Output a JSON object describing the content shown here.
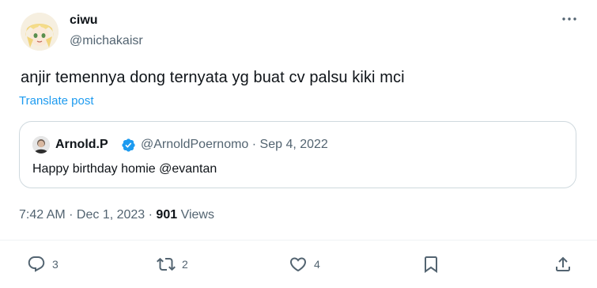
{
  "author": {
    "display_name": "ciwu",
    "handle": "@michakaisr",
    "avatar_icon": "anime-avatar"
  },
  "more_icon": "ellipsis-icon",
  "tweet": {
    "text": "anjir temennya dong ternyata yg buat cv palsu kiki mci",
    "translate_label": "Translate post"
  },
  "quoted": {
    "display_name": "Arnold.P",
    "verified": true,
    "handle_date": "@ArnoldPoernomo · Sep 4, 2022",
    "text": "Happy birthday homie @evantan"
  },
  "meta": {
    "time_date": "7:42 AM · Dec 1, 2023 · ",
    "views_count": "901",
    "views_label": " Views"
  },
  "actions": {
    "reply_count": "3",
    "repost_count": "2",
    "like_count": "4"
  },
  "colors": {
    "accent": "#1d9bf0",
    "secondary_text": "#536471",
    "border": "#cfd9de"
  }
}
